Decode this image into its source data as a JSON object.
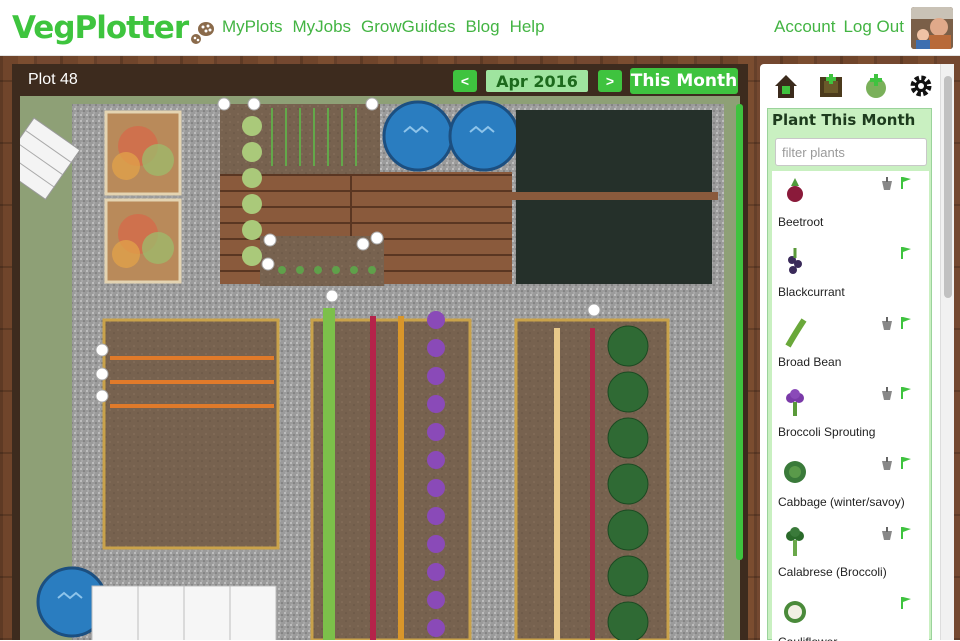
{
  "brand": {
    "logo_text": "VegPlotter"
  },
  "nav": {
    "items": [
      "MyPlots",
      "MyJobs",
      "GrowGuides",
      "Blog",
      "Help"
    ]
  },
  "account": {
    "account_label": "Account",
    "logout_label": "Log Out"
  },
  "plot": {
    "title": "Plot 48",
    "prev_label": "<",
    "month_label": "Apr 2016",
    "next_label": ">",
    "this_month_label": "This Month"
  },
  "sidebar": {
    "tools": [
      "house-icon",
      "frame-icon",
      "add-plant-icon",
      "gear-icon"
    ],
    "panel_title": "Plant This Month",
    "filter_placeholder": "filter plants",
    "plants": [
      {
        "name": "Beetroot",
        "pot": true,
        "flag": true
      },
      {
        "name": "Blackcurrant",
        "pot": false,
        "flag": true
      },
      {
        "name": "Broad Bean",
        "pot": true,
        "flag": true
      },
      {
        "name": "Broccoli Sprouting",
        "pot": true,
        "flag": true
      },
      {
        "name": "Cabbage (winter/savoy)",
        "pot": true,
        "flag": true
      },
      {
        "name": "Calabrese (Broccoli)",
        "pot": true,
        "flag": true
      },
      {
        "name": "Cauliflower",
        "pot": false,
        "flag": true
      }
    ]
  },
  "colors": {
    "accent": "#3fc33f",
    "nav_text": "#43b443",
    "panel_bg": "#c9f0c1"
  }
}
